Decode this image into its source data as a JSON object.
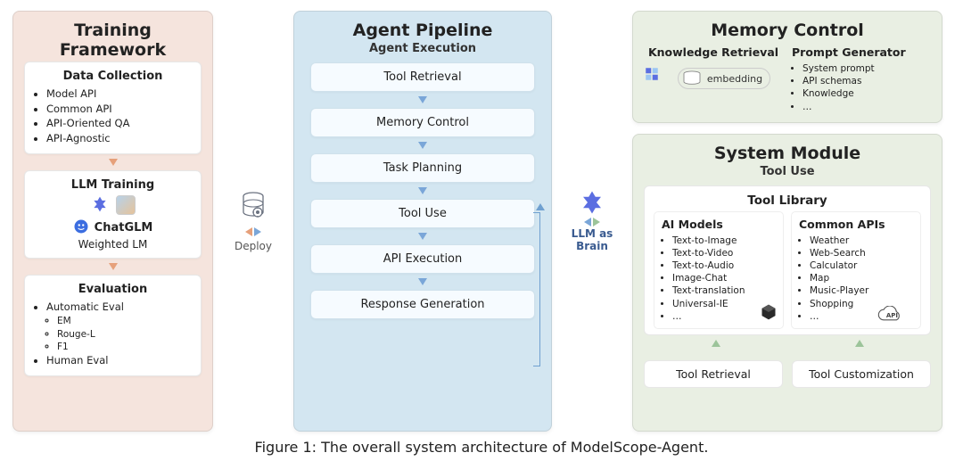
{
  "training": {
    "title": "Training Framework",
    "data_collection": {
      "title": "Data Collection",
      "items": [
        "Model API",
        "Common API",
        "API-Oriented QA",
        "API-Agnostic"
      ]
    },
    "llm_training": {
      "title": "LLM Training",
      "chatglm": "ChatGLM",
      "weighted": "Weighted LM"
    },
    "evaluation": {
      "title": "Evaluation",
      "items": [
        "Automatic Eval",
        "Human Eval"
      ],
      "sub_items": [
        "EM",
        "Rouge-L",
        "F1"
      ]
    }
  },
  "between": {
    "deploy": "Deploy"
  },
  "agent": {
    "title": "Agent Pipeline",
    "subtitle": "Agent Execution",
    "steps": [
      "Tool Retrieval",
      "Memory Control",
      "Task Planning",
      "Tool Use",
      "API Execution",
      "Response Generation"
    ]
  },
  "brain": {
    "line1": "LLM as",
    "line2": "Brain"
  },
  "memory": {
    "title": "Memory Control",
    "knowledge": {
      "title": "Knowledge Retrieval",
      "embedding": "embedding"
    },
    "prompt_gen": {
      "title": "Prompt Generator",
      "items": [
        "System prompt",
        "API schemas",
        "Knowledge",
        "…"
      ]
    }
  },
  "system": {
    "title": "System Module",
    "subtitle": "Tool Use",
    "tool_library": {
      "title": "Tool Library",
      "ai_models": {
        "title": "AI Models",
        "items": [
          "Text-to-Image",
          "Text-to-Video",
          "Text-to-Audio",
          "Image-Chat",
          "Text-translation",
          "Universal-IE",
          "…"
        ]
      },
      "common_apis": {
        "title": "Common APIs",
        "items": [
          "Weather",
          "Web-Search",
          "Calculator",
          "Map",
          "Music-Player",
          "Shopping",
          "…"
        ],
        "cloud_label": "API"
      }
    },
    "bottom": {
      "retrieval": "Tool Retrieval",
      "custom": "Tool Customization"
    }
  },
  "caption": "Figure 1: The overall system architecture of ModelScope-Agent."
}
